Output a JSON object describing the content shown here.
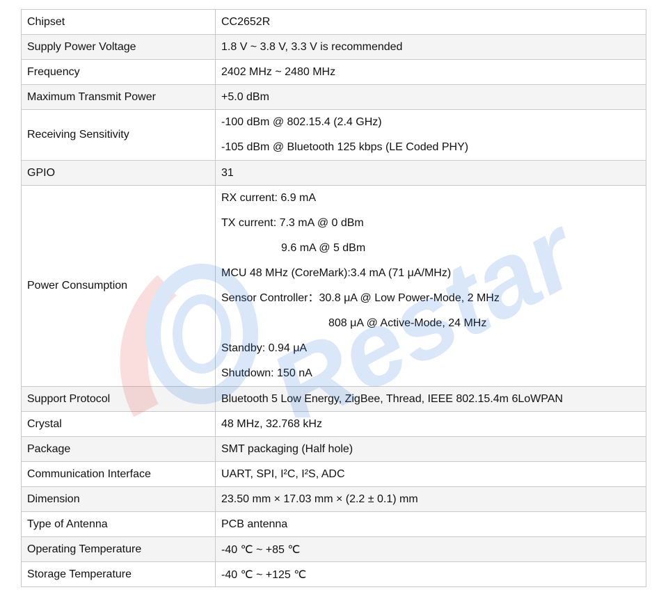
{
  "rows": [
    {
      "label": "Chipset",
      "values": [
        "CC2652R"
      ]
    },
    {
      "label": "Supply Power Voltage",
      "values": [
        "1.8 V ~ 3.8 V, 3.3 V is recommended"
      ]
    },
    {
      "label": "Frequency",
      "values": [
        "2402 MHz  ~  2480 MHz"
      ]
    },
    {
      "label": "Maximum Transmit Power",
      "values": [
        "+5.0 dBm"
      ]
    },
    {
      "label": "Receiving Sensitivity",
      "values": [
        "-100 dBm @ 802.15.4 (2.4 GHz)",
        "-105 dBm @ Bluetooth 125 kbps (LE Coded PHY)"
      ]
    },
    {
      "label": "GPIO",
      "values": [
        "31"
      ]
    },
    {
      "label": "Power Consumption",
      "values": [
        "RX current: 6.9 mA",
        "TX current: 7.3 mA @ 0 dBm",
        "9.6 mA @ 5 dBm",
        "MCU 48 MHz (CoreMark):3.4 mA (71 μA/MHz)",
        "Sensor Controller：30.8 μA @ Low Power-Mode, 2 MHz",
        "808 μA @ Active-Mode, 24 MHz",
        "Standby: 0.94 μA",
        "Shutdown: 150 nA"
      ]
    },
    {
      "label": "Support Protocol",
      "values": [
        "Bluetooth 5 Low Energy, ZigBee, Thread, IEEE 802.15.4m 6LoWPAN"
      ]
    },
    {
      "label": "Crystal",
      "values": [
        "48 MHz, 32.768 kHz"
      ]
    },
    {
      "label": "Package",
      "values": [
        "SMT packaging (Half hole)"
      ]
    },
    {
      "label": "Communication Interface",
      "values": [
        "UART, SPI, I²C, I²S, ADC"
      ]
    },
    {
      "label": "Dimension",
      "values": [
        "23.50 mm × 17.03 mm × (2.2 ± 0.1) mm"
      ]
    },
    {
      "label": "Type of Antenna",
      "values": [
        "PCB antenna"
      ]
    },
    {
      "label": "Operating Temperature",
      "values": [
        "-40 ℃  ~  +85 ℃"
      ]
    },
    {
      "label": "Storage Temperature",
      "values": [
        "-40 ℃  ~  +125 ℃"
      ]
    }
  ],
  "watermark": "Restar"
}
